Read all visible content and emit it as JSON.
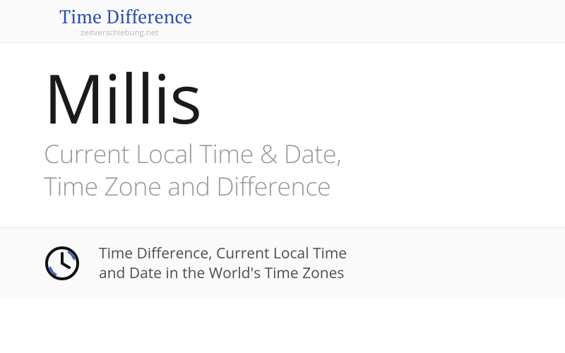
{
  "header": {
    "site_title": "Time Difference",
    "site_subtitle": "zeitverschiebung.net"
  },
  "main": {
    "city": "Millis",
    "subtitle_line1": "Current Local Time & Date,",
    "subtitle_line2": "Time Zone and Difference"
  },
  "footer": {
    "line1": "Time Difference, Current Local Time",
    "line2": "and Date in the World's Time Zones"
  }
}
